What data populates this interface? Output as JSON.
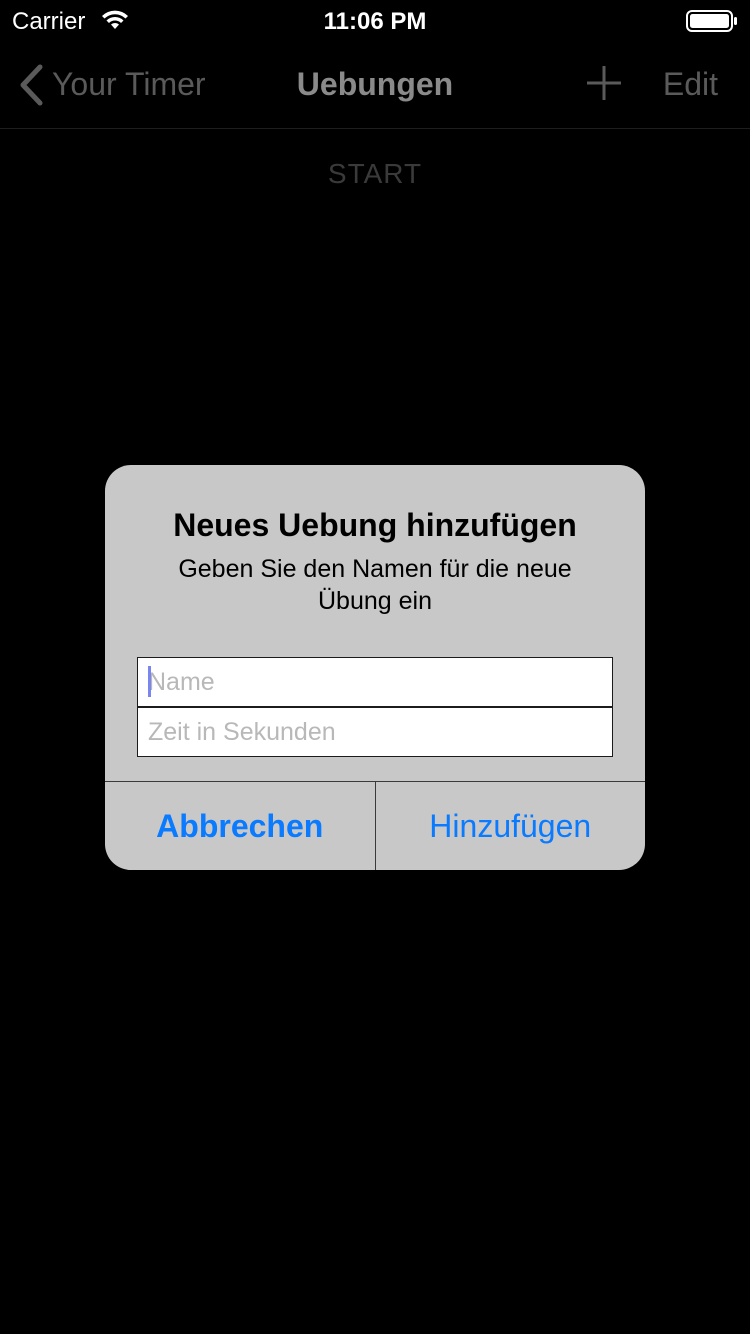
{
  "status_bar": {
    "carrier": "Carrier",
    "time": "11:06 PM",
    "wifi_icon": "wifi-icon",
    "battery_icon": "battery-icon"
  },
  "nav": {
    "back_label": "Your Timer",
    "title": "Uebungen",
    "add_icon": "plus-icon",
    "edit_label": "Edit"
  },
  "main": {
    "start_label": "START"
  },
  "alert": {
    "title": "Neues Uebung hinzufügen",
    "message": "Geben Sie den Namen für die neue Übung ein",
    "fields": {
      "name": {
        "value": "",
        "placeholder": "Name"
      },
      "seconds": {
        "value": "",
        "placeholder": "Zeit in Sekunden"
      }
    },
    "buttons": {
      "cancel": "Abbrechen",
      "add": "Hinzufügen"
    }
  },
  "colors": {
    "background": "#000000",
    "alert_background": "#c8c8c8",
    "accent": "#0a7aff"
  }
}
